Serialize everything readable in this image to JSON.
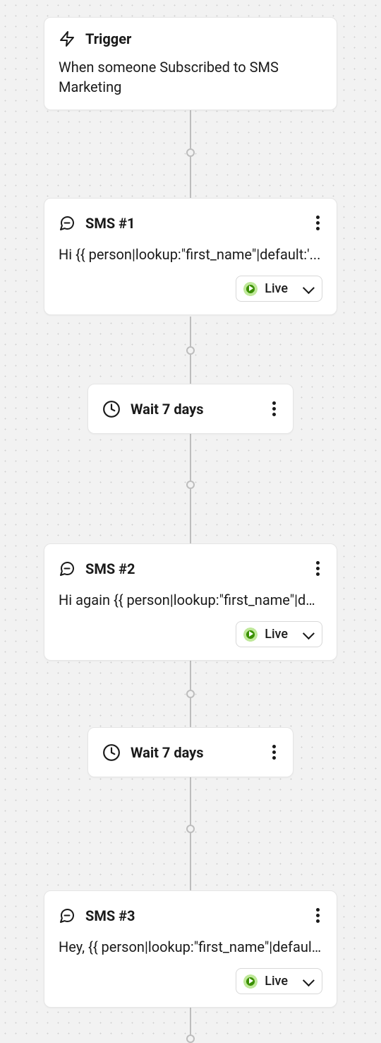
{
  "trigger": {
    "title": "Trigger",
    "description": "When someone Subscribed to SMS Marketing"
  },
  "sms1": {
    "title": "SMS #1",
    "preview": "Hi {{ person|lookup:\"first_name\"|default:'...",
    "status": "Live"
  },
  "wait1": {
    "label": "Wait 7 days"
  },
  "sms2": {
    "title": "SMS #2",
    "preview": "Hi again {{ person|lookup:\"first_name\"|de...",
    "status": "Live"
  },
  "wait2": {
    "label": "Wait 7 days"
  },
  "sms3": {
    "title": "SMS #3",
    "preview": "Hey, {{ person|lookup:\"first_name\"|defaul...",
    "status": "Live"
  }
}
